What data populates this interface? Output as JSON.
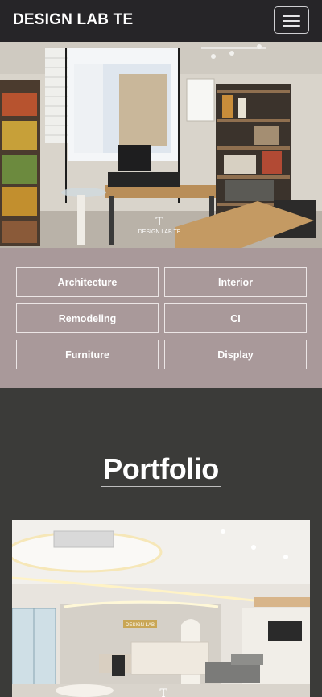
{
  "header": {
    "brand": "DESIGN LAB TE",
    "menu_icon": "hamburger-menu-icon"
  },
  "hero": {
    "logo_text": "DESIGN LAB TE"
  },
  "categories": [
    "Architecture",
    "Interior",
    "Remodeling",
    "CI",
    "Furniture",
    "Display"
  ],
  "portfolio": {
    "title": "Portfolio",
    "sign_text": "DESIGN LAB"
  },
  "colors": {
    "topbar": "#262528",
    "category_panel": "#a9999a",
    "portfolio_bg": "#3b3b39"
  }
}
